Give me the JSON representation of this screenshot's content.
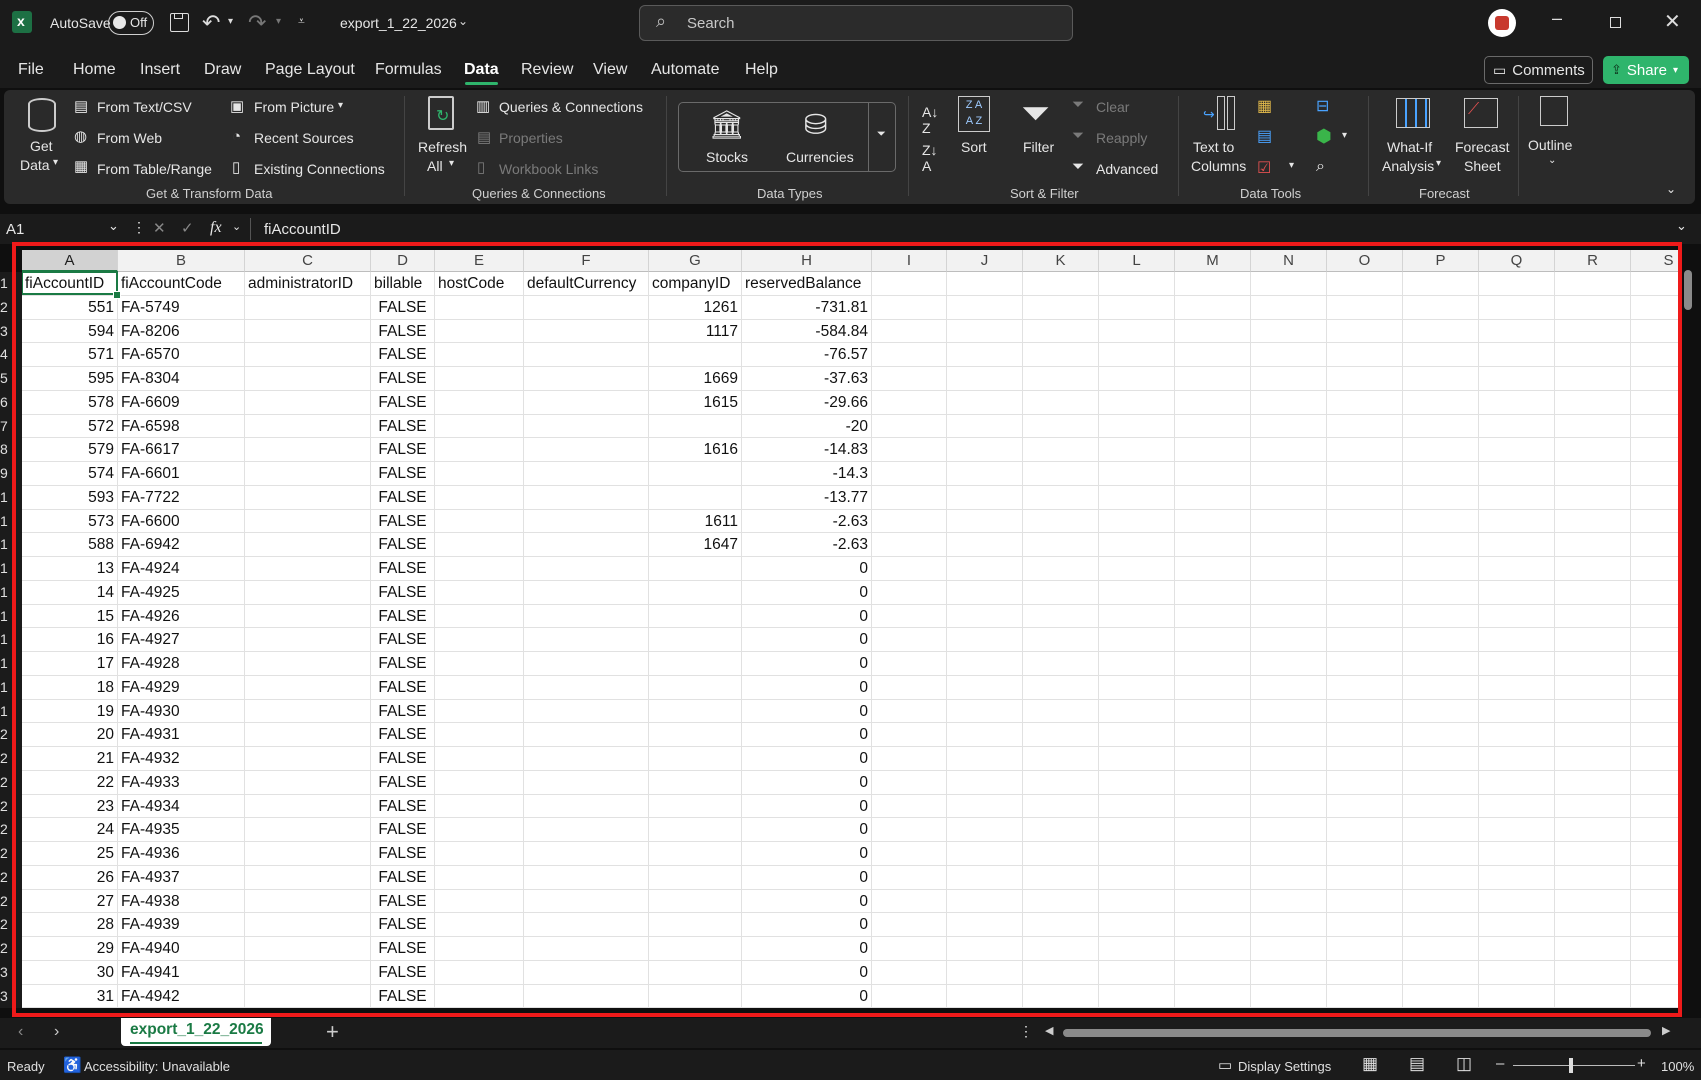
{
  "titlebar": {
    "autosave_label": "AutoSave",
    "autosave_state": "Off",
    "file_name": "export_1_22_2026",
    "search_placeholder": "Search"
  },
  "menu": {
    "tabs": [
      "File",
      "Home",
      "Insert",
      "Draw",
      "Page Layout",
      "Formulas",
      "Data",
      "Review",
      "View",
      "Automate",
      "Help"
    ],
    "active": "Data",
    "comments_label": "Comments",
    "share_label": "Share"
  },
  "ribbon": {
    "get_transform": {
      "get_data": [
        "Get",
        "Data"
      ],
      "from_text_csv": "From Text/CSV",
      "from_web": "From Web",
      "from_table_range": "From Table/Range",
      "from_picture": "From Picture",
      "recent_sources": "Recent Sources",
      "existing_connections": "Existing Connections",
      "group_label": "Get & Transform Data"
    },
    "queries": {
      "refresh_all": [
        "Refresh",
        "All"
      ],
      "queries_connections": "Queries & Connections",
      "properties": "Properties",
      "workbook_links": "Workbook Links",
      "group_label": "Queries & Connections"
    },
    "data_types": {
      "stocks": "Stocks",
      "currencies": "Currencies",
      "group_label": "Data Types"
    },
    "sort_filter": {
      "sort": "Sort",
      "filter": "Filter",
      "clear": "Clear",
      "reapply": "Reapply",
      "advanced": "Advanced",
      "group_label": "Sort & Filter"
    },
    "data_tools": {
      "text_to_columns": [
        "Text to",
        "Columns"
      ],
      "group_label": "Data Tools"
    },
    "forecast": {
      "what_if": [
        "What-If",
        "Analysis"
      ],
      "forecast_sheet": [
        "Forecast",
        "Sheet"
      ],
      "group_label": "Forecast"
    },
    "outline": {
      "label": "Outline"
    }
  },
  "formula_bar": {
    "name_box": "A1",
    "fx": "fx",
    "content": "fiAccountID"
  },
  "grid": {
    "columns": [
      "A",
      "B",
      "C",
      "D",
      "E",
      "F",
      "G",
      "H",
      "I",
      "J",
      "K",
      "L",
      "M",
      "N",
      "O",
      "P",
      "Q",
      "R",
      "S"
    ],
    "headers": [
      "fiAccountID",
      "fiAccountCode",
      "administratorID",
      "billable",
      "hostCode",
      "defaultCurrency",
      "companyID",
      "reservedBalance"
    ],
    "row_labels": [
      "1",
      "2",
      "3",
      "4",
      "5",
      "6",
      "7",
      "8",
      "9",
      "1",
      "1",
      "1",
      "1",
      "1",
      "1",
      "1",
      "1",
      "1",
      "1",
      "2",
      "2",
      "2",
      "2",
      "2",
      "2",
      "2",
      "2",
      "2",
      "2",
      "3",
      "3"
    ],
    "rows": [
      [
        "551",
        "FA-5749",
        "",
        "FALSE",
        "",
        "",
        "1261",
        "-731.81"
      ],
      [
        "594",
        "FA-8206",
        "",
        "FALSE",
        "",
        "",
        "1117",
        "-584.84"
      ],
      [
        "571",
        "FA-6570",
        "",
        "FALSE",
        "",
        "",
        "",
        "-76.57"
      ],
      [
        "595",
        "FA-8304",
        "",
        "FALSE",
        "",
        "",
        "1669",
        "-37.63"
      ],
      [
        "578",
        "FA-6609",
        "",
        "FALSE",
        "",
        "",
        "1615",
        "-29.66"
      ],
      [
        "572",
        "FA-6598",
        "",
        "FALSE",
        "",
        "",
        "",
        "-20"
      ],
      [
        "579",
        "FA-6617",
        "",
        "FALSE",
        "",
        "",
        "1616",
        "-14.83"
      ],
      [
        "574",
        "FA-6601",
        "",
        "FALSE",
        "",
        "",
        "",
        "-14.3"
      ],
      [
        "593",
        "FA-7722",
        "",
        "FALSE",
        "",
        "",
        "",
        "-13.77"
      ],
      [
        "573",
        "FA-6600",
        "",
        "FALSE",
        "",
        "",
        "1611",
        "-2.63"
      ],
      [
        "588",
        "FA-6942",
        "",
        "FALSE",
        "",
        "",
        "1647",
        "-2.63"
      ],
      [
        "13",
        "FA-4924",
        "",
        "FALSE",
        "",
        "",
        "",
        "0"
      ],
      [
        "14",
        "FA-4925",
        "",
        "FALSE",
        "",
        "",
        "",
        "0"
      ],
      [
        "15",
        "FA-4926",
        "",
        "FALSE",
        "",
        "",
        "",
        "0"
      ],
      [
        "16",
        "FA-4927",
        "",
        "FALSE",
        "",
        "",
        "",
        "0"
      ],
      [
        "17",
        "FA-4928",
        "",
        "FALSE",
        "",
        "",
        "",
        "0"
      ],
      [
        "18",
        "FA-4929",
        "",
        "FALSE",
        "",
        "",
        "",
        "0"
      ],
      [
        "19",
        "FA-4930",
        "",
        "FALSE",
        "",
        "",
        "",
        "0"
      ],
      [
        "20",
        "FA-4931",
        "",
        "FALSE",
        "",
        "",
        "",
        "0"
      ],
      [
        "21",
        "FA-4932",
        "",
        "FALSE",
        "",
        "",
        "",
        "0"
      ],
      [
        "22",
        "FA-4933",
        "",
        "FALSE",
        "",
        "",
        "",
        "0"
      ],
      [
        "23",
        "FA-4934",
        "",
        "FALSE",
        "",
        "",
        "",
        "0"
      ],
      [
        "24",
        "FA-4935",
        "",
        "FALSE",
        "",
        "",
        "",
        "0"
      ],
      [
        "25",
        "FA-4936",
        "",
        "FALSE",
        "",
        "",
        "",
        "0"
      ],
      [
        "26",
        "FA-4937",
        "",
        "FALSE",
        "",
        "",
        "",
        "0"
      ],
      [
        "27",
        "FA-4938",
        "",
        "FALSE",
        "",
        "",
        "",
        "0"
      ],
      [
        "28",
        "FA-4939",
        "",
        "FALSE",
        "",
        "",
        "",
        "0"
      ],
      [
        "29",
        "FA-4940",
        "",
        "FALSE",
        "",
        "",
        "",
        "0"
      ],
      [
        "30",
        "FA-4941",
        "",
        "FALSE",
        "",
        "",
        "",
        "0"
      ],
      [
        "31",
        "FA-4942",
        "",
        "FALSE",
        "",
        "",
        "",
        "0"
      ]
    ]
  },
  "sheet_tabs": {
    "active": "export_1_22_2026"
  },
  "status": {
    "ready": "Ready",
    "accessibility": "Accessibility: Unavailable",
    "display_settings": "Display Settings",
    "zoom": "100%"
  },
  "colors": {
    "excel_green": "#1a7a44",
    "share_green": "#2fb56c",
    "highlight_red": "#ef1a1a"
  }
}
